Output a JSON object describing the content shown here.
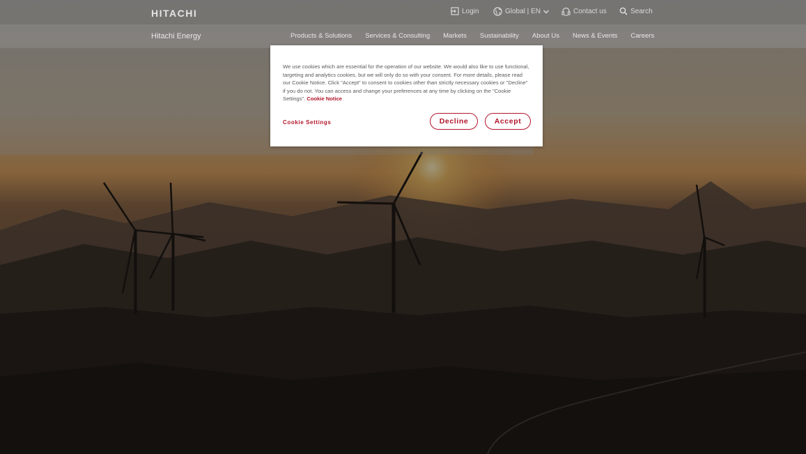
{
  "header": {
    "logo": "HITACHI",
    "login": "Login",
    "global": "Global | EN",
    "contact": "Contact us",
    "search": "Search"
  },
  "nav": {
    "brand": "Hitachi Energy",
    "items": [
      "Products & Solutions",
      "Services & Consulting",
      "Markets",
      "Sustainability",
      "About Us",
      "News & Events",
      "Careers"
    ]
  },
  "cookie_banner": {
    "text": "We use cookies which are essential for the operation of our website. We would also like to use functional, targeting and analytics cookies, but we will only do so with your consent. For more details, please read our Cookie Notice. Click \"Accept\" to consent to cookies other than strictly necessary cookies or \"Decline\" if you do not. You can access and change your preferences at any time by clicking on the \"Cookie Settings\".",
    "notice_link": "Cookie Notice",
    "settings": "Cookie Settings",
    "decline": "Decline",
    "accept": "Accept"
  },
  "colors": {
    "accent": "#b2152a",
    "topbar": "#787878",
    "navbar": "#8a8a8a"
  },
  "icons": {
    "login": "login-icon",
    "global": "globe-icon",
    "dropdown": "chevron-down-icon",
    "contact": "headset-icon",
    "search": "search-icon"
  }
}
